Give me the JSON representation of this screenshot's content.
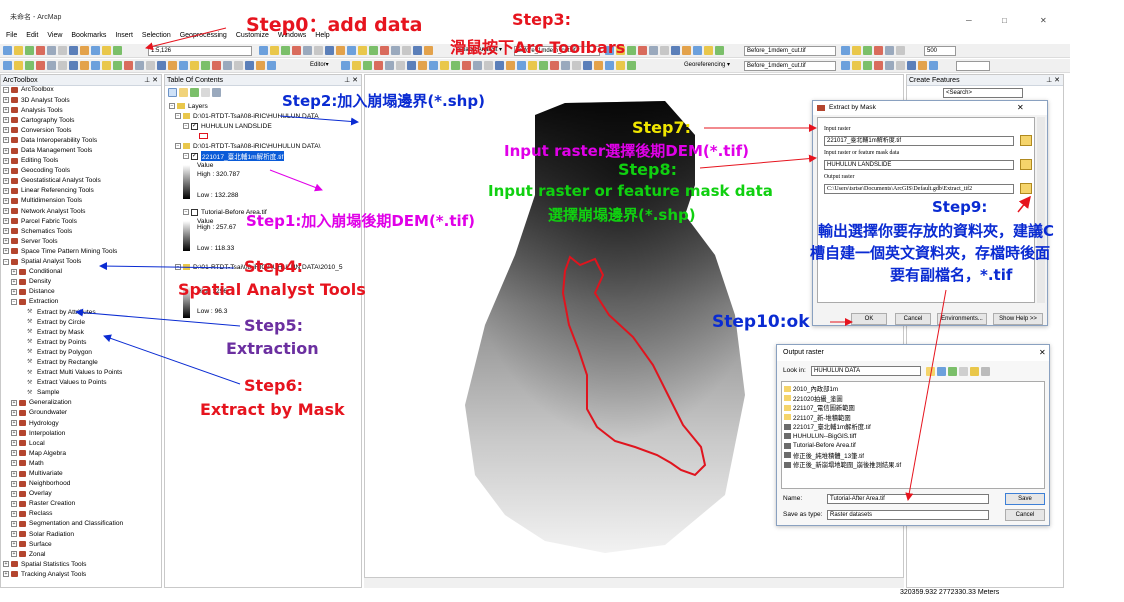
{
  "window": {
    "title": "未命名 - ArcMap",
    "minimize": "─",
    "maximize": "□",
    "close": "✕"
  },
  "menu": [
    "File",
    "Edit",
    "View",
    "Bookmarks",
    "Insert",
    "Selection",
    "Geoprocessing",
    "Customize",
    "Windows",
    "Help"
  ],
  "toolbar": {
    "scale": "1:5,126",
    "layer_select_1": "Before_1mdem_cut.tif",
    "layer_select_2": "Before_1mdem_cut.tif",
    "editor": "Editor▾",
    "zoom": "500",
    "georeferencing": "Georeferencing ▾",
    "georef_layer": "Before_1mdem_cut.tif",
    "spatial_analyst": "Spatial Analyst ▾"
  },
  "arctoolbox": {
    "title": "ArcToolbox",
    "root": "ArcToolbox",
    "items": [
      {
        "label": "3D Analyst Tools",
        "level": 0,
        "kind": "toolbox",
        "exp": "+"
      },
      {
        "label": "Analysis Tools",
        "level": 0,
        "kind": "toolbox",
        "exp": "+"
      },
      {
        "label": "Cartography Tools",
        "level": 0,
        "kind": "toolbox",
        "exp": "+"
      },
      {
        "label": "Conversion Tools",
        "level": 0,
        "kind": "toolbox",
        "exp": "+"
      },
      {
        "label": "Data Interoperability Tools",
        "level": 0,
        "kind": "toolbox",
        "exp": "+"
      },
      {
        "label": "Data Management Tools",
        "level": 0,
        "kind": "toolbox",
        "exp": "+"
      },
      {
        "label": "Editing Tools",
        "level": 0,
        "kind": "toolbox",
        "exp": "+"
      },
      {
        "label": "Geocoding Tools",
        "level": 0,
        "kind": "toolbox",
        "exp": "+"
      },
      {
        "label": "Geostatistical Analyst Tools",
        "level": 0,
        "kind": "toolbox",
        "exp": "+"
      },
      {
        "label": "Linear Referencing Tools",
        "level": 0,
        "kind": "toolbox",
        "exp": "+"
      },
      {
        "label": "Multidimension Tools",
        "level": 0,
        "kind": "toolbox",
        "exp": "+"
      },
      {
        "label": "Network Analyst Tools",
        "level": 0,
        "kind": "toolbox",
        "exp": "+"
      },
      {
        "label": "Parcel Fabric Tools",
        "level": 0,
        "kind": "toolbox",
        "exp": "+"
      },
      {
        "label": "Schematics Tools",
        "level": 0,
        "kind": "toolbox",
        "exp": "+"
      },
      {
        "label": "Server Tools",
        "level": 0,
        "kind": "toolbox",
        "exp": "+"
      },
      {
        "label": "Space Time Pattern Mining Tools",
        "level": 0,
        "kind": "toolbox",
        "exp": "+"
      },
      {
        "label": "Spatial Analyst Tools",
        "level": 0,
        "kind": "toolbox",
        "exp": "−"
      },
      {
        "label": "Conditional",
        "level": 1,
        "kind": "toolset",
        "exp": "+"
      },
      {
        "label": "Density",
        "level": 1,
        "kind": "toolset",
        "exp": "+"
      },
      {
        "label": "Distance",
        "level": 1,
        "kind": "toolset",
        "exp": "+"
      },
      {
        "label": "Extraction",
        "level": 1,
        "kind": "toolset",
        "exp": "−"
      },
      {
        "label": "Extract by Attributes",
        "level": 2,
        "kind": "tool"
      },
      {
        "label": "Extract by Circle",
        "level": 2,
        "kind": "tool"
      },
      {
        "label": "Extract by Mask",
        "level": 2,
        "kind": "tool"
      },
      {
        "label": "Extract by Points",
        "level": 2,
        "kind": "tool"
      },
      {
        "label": "Extract by Polygon",
        "level": 2,
        "kind": "tool"
      },
      {
        "label": "Extract by Rectangle",
        "level": 2,
        "kind": "tool"
      },
      {
        "label": "Extract Multi Values to Points",
        "level": 2,
        "kind": "tool"
      },
      {
        "label": "Extract Values to Points",
        "level": 2,
        "kind": "tool"
      },
      {
        "label": "Sample",
        "level": 2,
        "kind": "tool"
      },
      {
        "label": "Generalization",
        "level": 1,
        "kind": "toolset",
        "exp": "+"
      },
      {
        "label": "Groundwater",
        "level": 1,
        "kind": "toolset",
        "exp": "+"
      },
      {
        "label": "Hydrology",
        "level": 1,
        "kind": "toolset",
        "exp": "+"
      },
      {
        "label": "Interpolation",
        "level": 1,
        "kind": "toolset",
        "exp": "+"
      },
      {
        "label": "Local",
        "level": 1,
        "kind": "toolset",
        "exp": "+"
      },
      {
        "label": "Map Algebra",
        "level": 1,
        "kind": "toolset",
        "exp": "+"
      },
      {
        "label": "Math",
        "level": 1,
        "kind": "toolset",
        "exp": "+"
      },
      {
        "label": "Multivariate",
        "level": 1,
        "kind": "toolset",
        "exp": "+"
      },
      {
        "label": "Neighborhood",
        "level": 1,
        "kind": "toolset",
        "exp": "+"
      },
      {
        "label": "Overlay",
        "level": 1,
        "kind": "toolset",
        "exp": "+"
      },
      {
        "label": "Raster Creation",
        "level": 1,
        "kind": "toolset",
        "exp": "+"
      },
      {
        "label": "Reclass",
        "level": 1,
        "kind": "toolset",
        "exp": "+"
      },
      {
        "label": "Segmentation and Classification",
        "level": 1,
        "kind": "toolset",
        "exp": "+"
      },
      {
        "label": "Solar Radiation",
        "level": 1,
        "kind": "toolset",
        "exp": "+"
      },
      {
        "label": "Surface",
        "level": 1,
        "kind": "toolset",
        "exp": "+"
      },
      {
        "label": "Zonal",
        "level": 1,
        "kind": "toolset",
        "exp": "+"
      },
      {
        "label": "Spatial Statistics Tools",
        "level": 0,
        "kind": "toolbox",
        "exp": "+"
      },
      {
        "label": "Tracking Analyst Tools",
        "level": 0,
        "kind": "toolbox",
        "exp": "+"
      }
    ]
  },
  "toc": {
    "title": "Table Of Contents",
    "layers_label": "Layers",
    "group1": "D:\\01-RTDT-Tsai\\08-iRIC\\HUHULUN DATA",
    "shp_layer": "HUHULUN LANDSLIDE",
    "group2": "D:\\01-RTDT-Tsai\\08-iRIC\\HUHULUN DATA\\",
    "dem_after": "221017_臺北輔1m解析度.tif",
    "value_label": "Value",
    "high1": "High : 320.787",
    "low1": "Low : 132.288",
    "tutorial_before": "Tutorial-Before Area.tif",
    "high2": "High : 257.67",
    "low2": "Low : 118.33",
    "group3": "D:\\01-RTDT-Tsai\\08-iRIC\\HUHULUN DATA\\2010_5",
    "high3": "High : 296",
    "low3": "Low : 96.3"
  },
  "create_features": {
    "title": "Create Features",
    "search": "<Search>"
  },
  "extract_by_mask": {
    "title": "Extract by Mask",
    "input_raster_label": "Input raster",
    "input_raster_value": "221017_臺北輔1m解析度.tif",
    "mask_label": "Input raster or feature mask data",
    "mask_value": "HUHULUN LANDSLIDE",
    "output_label": "Output raster",
    "output_value": "C:\\Users\\tsrtse\\Documents\\ArcGIS\\Default.gdb\\Extract_tif2",
    "ok": "OK",
    "cancel": "Cancel",
    "environments": "Environments...",
    "show_help": "Show Help >>"
  },
  "output_raster": {
    "title": "Output raster",
    "look_in_label": "Look in:",
    "look_in_value": "HUHULUN DATA",
    "files": [
      {
        "name": "2010_內政部1m",
        "type": "folder"
      },
      {
        "name": "221020拍攝_塗圖",
        "type": "folder"
      },
      {
        "name": "221107_電信圖新範圍",
        "type": "folder"
      },
      {
        "name": "221107_新-堆積範圍",
        "type": "folder"
      },
      {
        "name": "221017_臺北輔1m解析度.tif",
        "type": "raster"
      },
      {
        "name": "HUHULUN--BigGIS.tiff",
        "type": "raster"
      },
      {
        "name": "Tutorial-Before Area.tif",
        "type": "raster"
      },
      {
        "name": "修正後_純堆積體_13筆.tif",
        "type": "raster"
      },
      {
        "name": "修正後_新崩塌地範圍_崩後推測結果.tif",
        "type": "raster"
      }
    ],
    "name_label": "Name:",
    "name_value": "Tutorial-After Area.tif",
    "save_type_label": "Save as type:",
    "save_type_value": "Raster datasets",
    "save": "Save",
    "cancel": "Cancel"
  },
  "status": {
    "coordinates": "320359.932  2772330.33 Meters"
  },
  "annotations": {
    "step0": "Step0：add data",
    "step1": "Step1:加入崩塌後期DEM(*.tif)",
    "step2": "Step2:加入崩塌邊界(*.shp)",
    "step3_line1": "Step3:",
    "step3_line2": "滑鼠按下Arc Toolbars",
    "step4_line1": "Step4:",
    "step4_line2": "Spatial Analyst Tools",
    "step5_line1": "Step5:",
    "step5_line2": "Extraction",
    "step6_line1": "Step6:",
    "step6_line2": "Extract by Mask",
    "step7_line1": "Step7:",
    "step7_line2": "Input raster選擇後期DEM(*.tif)",
    "step8_line1": "Step8:",
    "step8_line2": "Input raster or feature mask data",
    "step8_line3": "選擇崩塌邊界(*.shp)",
    "step9_line1": "Step9:",
    "step9_line2": "輸出選擇你要存放的資料夾，建議C",
    "step9_line3": "槽自建一個英文資料夾，存檔時後面",
    "step9_line4": "要有副檔名，*.tif",
    "step10": "Step10:ok"
  },
  "colors": {
    "annotation_red": "#e6141e",
    "annotation_blue": "#0a2bd2",
    "annotation_magenta": "#e000e8",
    "annotation_yellow": "#f0e600",
    "annotation_green": "#10d010",
    "annotation_purple": "#6b2fa0",
    "landslide_boundary": "#e0141e",
    "toolbox_icon": "#b4452e"
  }
}
